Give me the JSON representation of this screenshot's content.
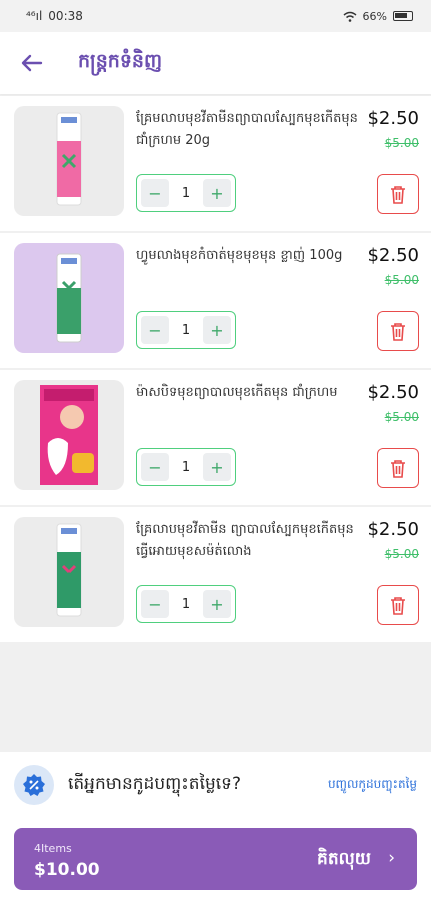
{
  "status_bar": {
    "signal": "⁴⁶ıl",
    "time": "00:38",
    "battery": "66%"
  },
  "header": {
    "title": "កន្ត្រកទំនិញ",
    "back_icon": "arrow-left-icon"
  },
  "cart": {
    "items": [
      {
        "name": "គ្រែមលាបមុខវីតាមីនព្យាបាលស្បែកមុខកើតមុន ជាំក្រហម 20g",
        "price": "$2.50",
        "old_price": "$5.00",
        "qty": "1"
      },
      {
        "name": "ហ្វូមលាងមុខកំចាត់មុខមុខមុន ខ្លាញ់ 100g",
        "price": "$2.50",
        "old_price": "$5.00",
        "qty": "1"
      },
      {
        "name": "ម៉ាសបិទមុខព្យាបាលមុខកើតមុន ជាំក្រហម",
        "price": "$2.50",
        "old_price": "$5.00",
        "qty": "1"
      },
      {
        "name": "គ្រែលាបមុខវីតាមីន ព្យាបាលស្បែកមុខកើតមុនធ្វើអោយមុខសម៉ត់លោង",
        "price": "$2.50",
        "old_price": "$5.00",
        "qty": "1"
      }
    ],
    "minus_symbol": "−",
    "plus_symbol": "+"
  },
  "promo": {
    "question": "តើអ្នកមានកូដបញ្ចុះតម្លៃទេ?",
    "link": "បញ្ចូលកូដបញ្ចុះតម្លៃ",
    "icon": "discount-icon"
  },
  "checkout": {
    "count": "4Items",
    "total": "$10.00",
    "label": "គិតលុយ",
    "arrow": "›"
  },
  "colors": {
    "accent": "#8a5bb7",
    "green": "#4fcf7e",
    "red": "#e84b4b",
    "link": "#2a6fd9"
  }
}
